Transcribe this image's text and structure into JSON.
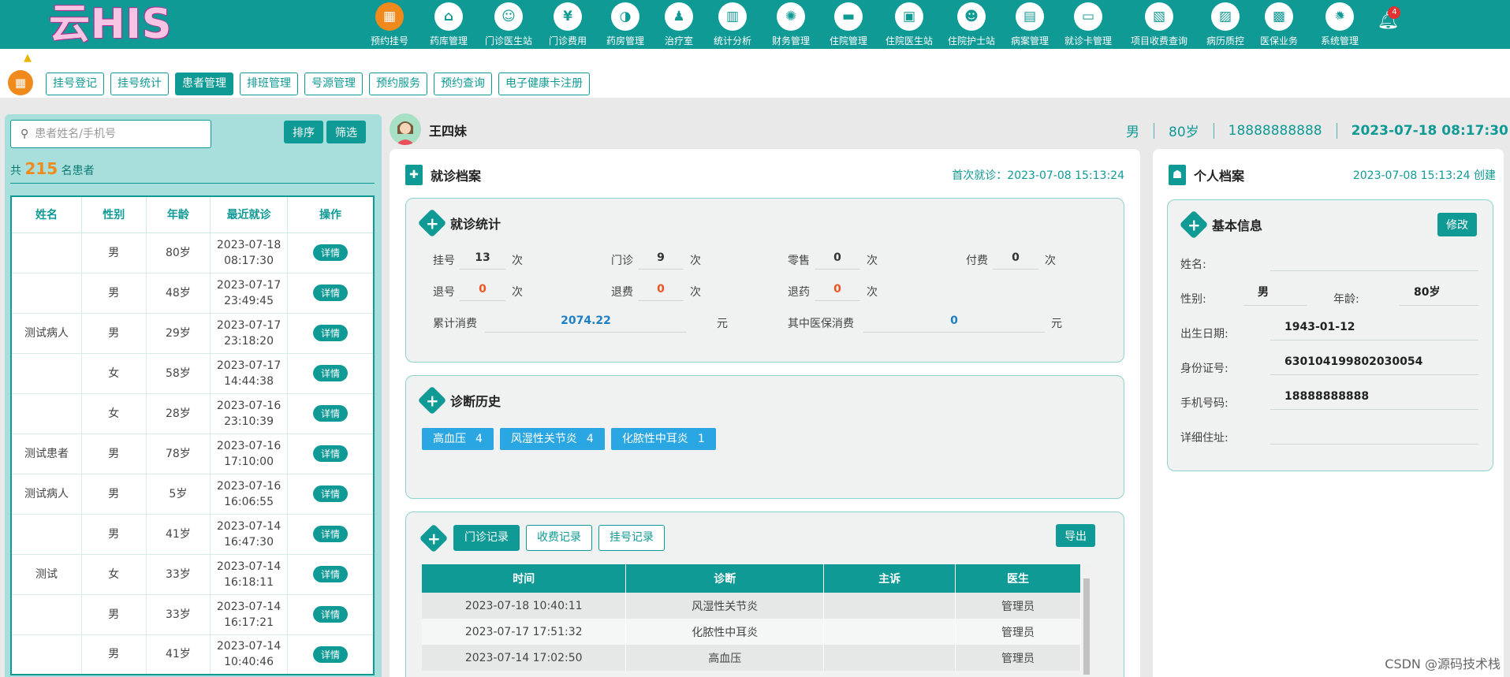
{
  "app": {
    "logo": "云HIS"
  },
  "nav": [
    {
      "label": "预约挂号",
      "icon": "calendar-icon",
      "glyph": "▦",
      "active": true
    },
    {
      "label": "药库管理",
      "icon": "warehouse-icon",
      "glyph": "⌂"
    },
    {
      "label": "门诊医生站",
      "icon": "doctor-icon",
      "glyph": "☺"
    },
    {
      "label": "门诊费用",
      "icon": "yen-icon",
      "glyph": "¥"
    },
    {
      "label": "药房管理",
      "icon": "pill-icon",
      "glyph": "◑"
    },
    {
      "label": "治疗室",
      "icon": "nurse-icon",
      "glyph": "♟"
    },
    {
      "label": "统计分析",
      "icon": "bar-chart-icon",
      "glyph": "▥"
    },
    {
      "label": "财务管理",
      "icon": "gear-icon",
      "glyph": "✺"
    },
    {
      "label": "住院管理",
      "icon": "bed-icon",
      "glyph": "▬"
    },
    {
      "label": "住院医生站",
      "icon": "id-card-icon",
      "glyph": "▣"
    },
    {
      "label": "住院护士站",
      "icon": "nurse-station-icon",
      "glyph": "☻"
    },
    {
      "label": "病案管理",
      "icon": "record-icon",
      "glyph": "▤"
    },
    {
      "label": "就诊卡管理",
      "icon": "card-icon",
      "glyph": "▭"
    },
    {
      "label": "项目收费查询",
      "icon": "invoice-icon",
      "glyph": "▧"
    },
    {
      "label": "病历质控",
      "icon": "quality-icon",
      "glyph": "▨"
    },
    {
      "label": "医保业务",
      "icon": "insurance-icon",
      "glyph": "▩"
    },
    {
      "label": "系统管理",
      "icon": "settings-icon",
      "glyph": "✹"
    }
  ],
  "header_right": {
    "bell_count": "4"
  },
  "subtabs": [
    {
      "label": "挂号登记"
    },
    {
      "label": "挂号统计"
    },
    {
      "label": "患者管理",
      "active": true
    },
    {
      "label": "排班管理"
    },
    {
      "label": "号源管理"
    },
    {
      "label": "预约服务"
    },
    {
      "label": "预约查询"
    },
    {
      "label": "电子健康卡注册"
    }
  ],
  "left": {
    "search_placeholder": "患者姓名/手机号",
    "sort_label": "排序",
    "filter_label": "筛选",
    "count_prefix": "共",
    "count": "215",
    "count_suffix": "名患者",
    "columns": [
      "姓名",
      "性别",
      "年龄",
      "最近就诊",
      "操作"
    ],
    "detail_label": "详情",
    "rows": [
      {
        "name": "",
        "gender": "男",
        "age": "80岁",
        "date": "2023-07-18",
        "time": "08:17:30"
      },
      {
        "name": "",
        "gender": "男",
        "age": "48岁",
        "date": "2023-07-17",
        "time": "23:49:45"
      },
      {
        "name": "测试病人",
        "gender": "男",
        "age": "29岁",
        "date": "2023-07-17",
        "time": "23:18:20"
      },
      {
        "name": "",
        "gender": "女",
        "age": "58岁",
        "date": "2023-07-17",
        "time": "14:44:38"
      },
      {
        "name": "",
        "gender": "女",
        "age": "28岁",
        "date": "2023-07-16",
        "time": "23:10:39"
      },
      {
        "name": "测试患者",
        "gender": "男",
        "age": "78岁",
        "date": "2023-07-16",
        "time": "17:10:00"
      },
      {
        "name": "测试病人",
        "gender": "男",
        "age": "5岁",
        "date": "2023-07-16",
        "time": "16:06:55"
      },
      {
        "name": "",
        "gender": "男",
        "age": "41岁",
        "date": "2023-07-14",
        "time": "16:47:30"
      },
      {
        "name": "测试",
        "gender": "女",
        "age": "33岁",
        "date": "2023-07-14",
        "time": "16:18:11"
      },
      {
        "name": "",
        "gender": "男",
        "age": "33岁",
        "date": "2023-07-14",
        "time": "16:17:21"
      },
      {
        "name": "",
        "gender": "男",
        "age": "41岁",
        "date": "2023-07-14",
        "time": "10:40:46"
      }
    ]
  },
  "patient": {
    "name": "王四妹",
    "gender": "男",
    "age": "80岁",
    "phone": "18888888888",
    "last_visit": "2023-07-18 08:17:30"
  },
  "visit_file": {
    "title": "就诊档案",
    "first_visit": "首次就诊：2023-07-08 15:13:24",
    "stats": {
      "title": "就诊统计",
      "registration_label": "挂号",
      "registration": "13",
      "outpatient_label": "门诊",
      "outpatient": "9",
      "retail_label": "零售",
      "retail": "0",
      "payment_label": "付费",
      "payment": "0",
      "refund_reg_label": "退号",
      "refund_reg": "0",
      "refund_fee_label": "退费",
      "refund_fee": "0",
      "refund_drug_label": "退药",
      "refund_drug": "0",
      "unit_times": "次",
      "total_label": "累计消费",
      "total": "2074.22",
      "insurance_label": "其中医保消费",
      "insurance": "0",
      "unit_yuan": "元"
    },
    "diagnosis": {
      "title": "诊断历史",
      "tags": [
        {
          "name": "高血压",
          "count": "4"
        },
        {
          "name": "风湿性关节炎",
          "count": "4"
        },
        {
          "name": "化脓性中耳炎",
          "count": "1"
        }
      ]
    },
    "records": {
      "tabs": [
        {
          "label": "门诊记录",
          "active": true
        },
        {
          "label": "收费记录"
        },
        {
          "label": "挂号记录"
        }
      ],
      "export_label": "导出",
      "columns": [
        "时间",
        "诊断",
        "主诉",
        "医生"
      ],
      "rows": [
        {
          "time": "2023-07-18 10:40:11",
          "diagnosis": "风湿性关节炎",
          "complaint": "",
          "doctor": "管理员"
        },
        {
          "time": "2023-07-17 17:51:32",
          "diagnosis": "化脓性中耳炎",
          "complaint": "",
          "doctor": "管理员"
        },
        {
          "time": "2023-07-14 17:02:50",
          "diagnosis": "高血压",
          "complaint": "",
          "doctor": "管理员"
        }
      ]
    }
  },
  "personal_file": {
    "title": "个人档案",
    "created": "2023-07-08 15:13:24 创建",
    "basic_title": "基本信息",
    "edit_label": "修改",
    "name_label": "姓名:",
    "name_value": "",
    "gender_label": "性别:",
    "gender_value": "男",
    "age_label": "年龄:",
    "age_value": "80岁",
    "birth_label": "出生日期:",
    "birth_value": "1943-01-12",
    "id_label": "身份证号:",
    "id_value": "630104199802030054",
    "phone_label": "手机号码:",
    "phone_value": "18888888888",
    "address_label": "详细住址:",
    "address_value": ""
  },
  "watermark": "CSDN @源码技术栈",
  "colors": {
    "primary": "#0f9a96",
    "accent": "#f08a1c",
    "tag": "#2aa7e2",
    "badge": "#e53030"
  }
}
